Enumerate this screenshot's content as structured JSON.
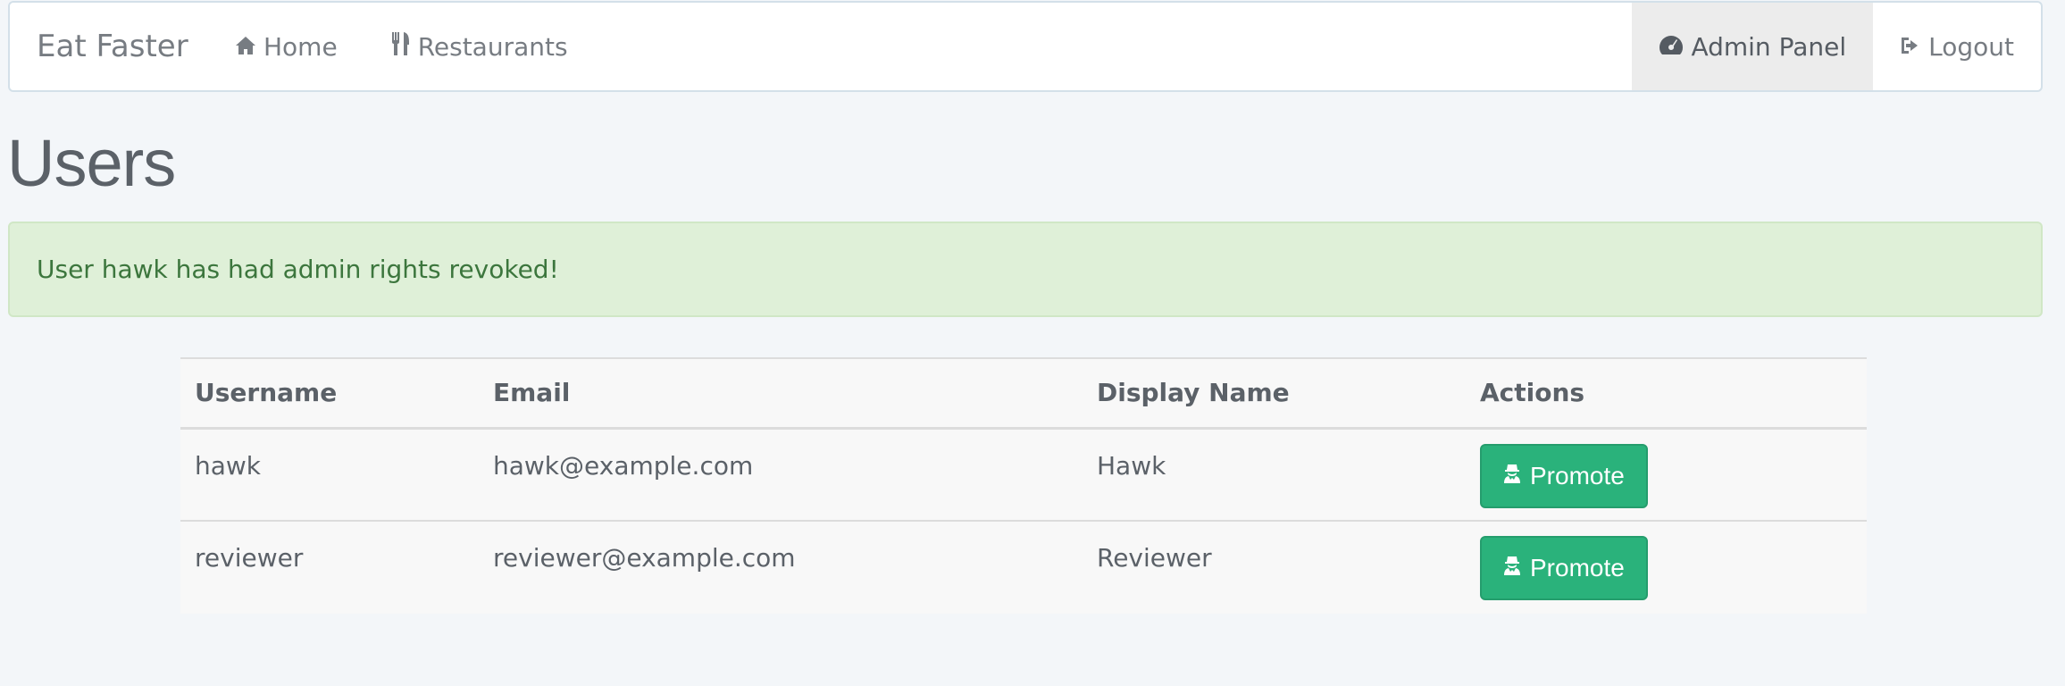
{
  "navbar": {
    "brand": "Eat Faster",
    "left_links": [
      {
        "label": "Home",
        "icon": "home-icon"
      },
      {
        "label": "Restaurants",
        "icon": "utensils-icon"
      }
    ],
    "right_links": [
      {
        "label": "Admin Panel",
        "icon": "dashboard-icon",
        "active": true
      },
      {
        "label": "Logout",
        "icon": "logout-icon",
        "active": false
      }
    ]
  },
  "page": {
    "title": "Users"
  },
  "alert": {
    "message": "User hawk has had admin rights revoked!",
    "color": "#dff0d8"
  },
  "users_table": {
    "headers": [
      "Username",
      "Email",
      "Display Name",
      "Actions"
    ],
    "rows": [
      {
        "username": "hawk",
        "email": "hawk@example.com",
        "display_name": "Hawk",
        "action_label": "Promote"
      },
      {
        "username": "reviewer",
        "email": "reviewer@example.com",
        "display_name": "Reviewer",
        "action_label": "Promote"
      }
    ]
  },
  "colors": {
    "accent_green": "#2ab27b",
    "page_background": "#f3f6f9"
  }
}
